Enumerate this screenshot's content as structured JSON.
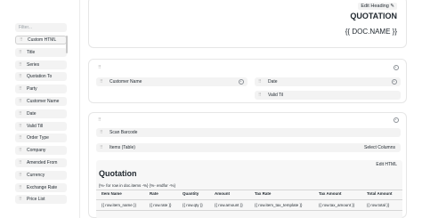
{
  "sidebar": {
    "filter_placeholder": "Filter...",
    "items": [
      {
        "label": "Custom HTML"
      },
      {
        "label": "Title"
      },
      {
        "label": "Series"
      },
      {
        "label": "Quotation To"
      },
      {
        "label": "Party"
      },
      {
        "label": "Customer Name"
      },
      {
        "label": "Date"
      },
      {
        "label": "Valid Till"
      },
      {
        "label": "Order Type"
      },
      {
        "label": "Company"
      },
      {
        "label": "Amended From"
      },
      {
        "label": "Currency"
      },
      {
        "label": "Exchange Rate"
      },
      {
        "label": "Price List"
      }
    ]
  },
  "header": {
    "edit_heading_label": "Edit Heading",
    "edit_icon": "pencil-icon",
    "title": "QUOTATION",
    "doc_name": "{{ DOC.NAME }}"
  },
  "section1": {
    "handle": "⠿",
    "fields": [
      {
        "label": "Customer Name"
      },
      {
        "label": "Date"
      },
      {
        "label": "Valid Til"
      }
    ]
  },
  "section2": {
    "handle": "⠿",
    "scan_barcode": "Scan Barcode",
    "items_table": "Items (Table)",
    "select_columns": "Select Columns",
    "custom_html": {
      "edit_html_label": "Edit HTML",
      "title": "Quotation",
      "code_line": "{%- for row in doc.items -%} {%- endfor -%}",
      "columns": [
        "Item Name",
        "Rate",
        "Quantity",
        "Amount",
        "Tax Rate",
        "Tax Amount",
        "Total Amount"
      ],
      "values": [
        "{{ row.item_name }}",
        "{{ row.rate }}",
        "{{ row.qty }}",
        "{{ row.amount }}",
        "{{ row.item_tax_template }}",
        "{{ row.tax_amount }}",
        "{{ row.total }}"
      ]
    }
  },
  "icons": {
    "drag": "drag-handle-icon",
    "settings": "gear-icon"
  }
}
